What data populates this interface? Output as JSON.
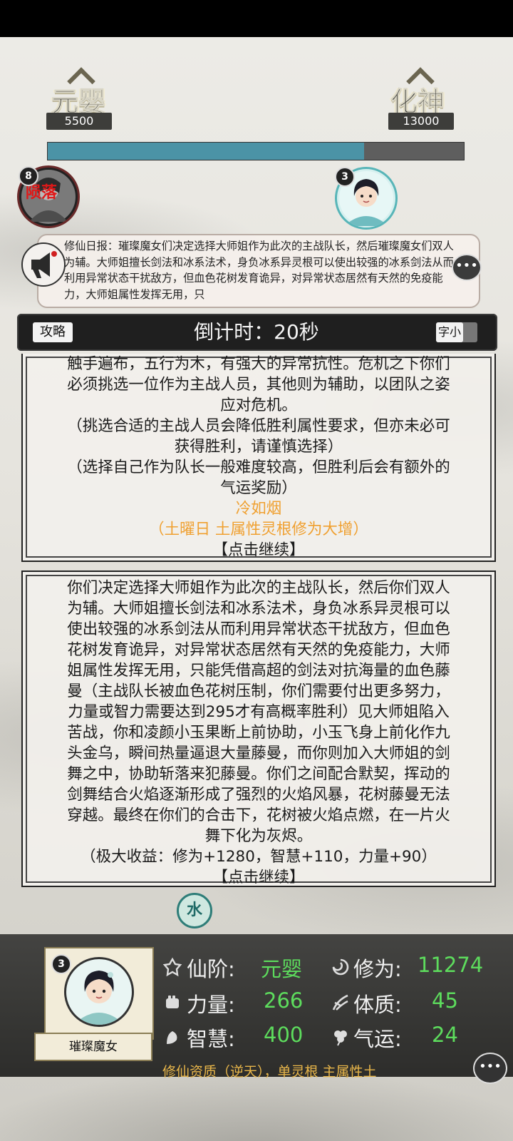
{
  "ranks": {
    "current_name": "元婴",
    "current_value": "5500",
    "next_name": "化神",
    "next_value": "13000",
    "progress_fraction": 0.76
  },
  "left_badge": {
    "level": "8",
    "status": "陨落"
  },
  "right_badge": {
    "level": "3"
  },
  "news": {
    "text": "修仙日报：璀璨魔女们决定选择大师姐作为此次的主战队长，然后璀璨魔女们双人为辅。大师姐擅长剑法和冰系法术，身负冰系异灵根可以使出较强的冰系剑法从而利用异常状态干扰敌方，但血色花树发育诡异，对异常状态居然有天然的免疫能力，大师姐属性发挥无用，只"
  },
  "topbar": {
    "guide_label": "攻略",
    "countdown": "倒计时：20秒",
    "font_toggle_label": "字小"
  },
  "panel1": {
    "lines": [
      "触手遍布，五行为木，有强大的异常抗性。危机之下你们",
      "必须挑选一位作为主战人员，其他则为辅助，以团队之姿",
      "应对危机。",
      "（挑选合适的主战人员会降低胜利属性要求，但亦未必可",
      "获得胜利，请谨慎选择）",
      "（选择自己作为队长一般难度较高，但胜利后会有额外的",
      "气运奖励）"
    ],
    "highlight_name": "冷如烟",
    "highlight_note": "（土曜日 土属性灵根修为大增）",
    "continue_label": "【点击继续】"
  },
  "panel2": {
    "lines": [
      "你们决定选择大师姐作为此次的主战队长，然后你们双人",
      "为辅。大师姐擅长剑法和冰系法术，身负冰系异灵根可以",
      "使出较强的冰系剑法从而利用异常状态干扰敌方，但血色",
      "花树发育诡异，对异常状态居然有天然的免疫能力，大师",
      "姐属性发挥无用，只能凭借高超的剑法对抗海量的血色藤",
      "曼（主战队长被血色花树压制，你们需要付出更多努力，",
      "力量或智力需要达到295才有高概率胜利）见大师姐陷入",
      "苦战，你和凌颜小玉果断上前协助，小玉飞身上前化作九",
      "头金乌，瞬间热量逼退大量藤曼，而你则加入大师姐的剑",
      "舞之中，协助斩落来犯藤曼。你们之间配合默契，挥动的",
      "剑舞结合火焰逐渐形成了强烈的火焰风暴，花树藤曼无法",
      "穿越。最终在你们的合击下，花树被火焰点燃，在一片火",
      "舞下化为灰烬。"
    ],
    "reward": "（极大收益：修为+1280，智慧+110，力量+90）",
    "continue_label": "【点击继续】"
  },
  "element_badge": "水",
  "player": {
    "level": "3",
    "name": "璀璨魔女",
    "stats": {
      "realm_label": "仙阶:",
      "realm_value": "元婴",
      "cultivation_label": "修为:",
      "cultivation_value": "11274",
      "strength_label": "力量:",
      "strength_value": "266",
      "constitution_label": "体质:",
      "constitution_value": "45",
      "wisdom_label": "智慧:",
      "wisdom_value": "400",
      "luck_label": "气运:",
      "luck_value": "24"
    },
    "aptitude": "修仙资质（逆天），单灵根 主属性土"
  },
  "colors": {
    "progress": "#4b93a6",
    "highlight": "#f0a030",
    "stat_value": "#5ddc5d",
    "aptitude": "#e8b64a"
  }
}
